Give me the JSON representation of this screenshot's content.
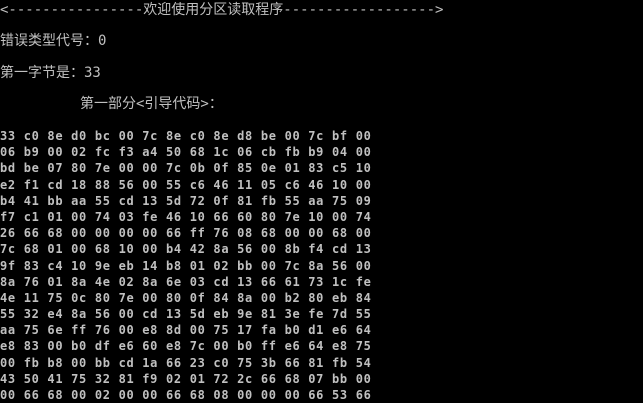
{
  "console": {
    "title_line": "<----------------欢迎使用分区读取程序------------------>",
    "error_type_label": "错误类型代号：",
    "error_type_value": "0",
    "first_byte_label": "第一字节是：",
    "first_byte_value": "33",
    "part1_heading": "第一部分<引导代码>：",
    "hex_rows": [
      "33 c0 8e d0 bc 00 7c 8e c0 8e d8 be 00 7c bf 00",
      "06 b9 00 02 fc f3 a4 50 68 1c 06 cb fb b9 04 00",
      "bd be 07 80 7e 00 00 7c 0b 0f 85 0e 01 83 c5 10",
      "e2 f1 cd 18 88 56 00 55 c6 46 11 05 c6 46 10 00",
      "b4 41 bb aa 55 cd 13 5d 72 0f 81 fb 55 aa 75 09",
      "f7 c1 01 00 74 03 fe 46 10 66 60 80 7e 10 00 74",
      "26 66 68 00 00 00 00 66 ff 76 08 68 00 00 68 00",
      "7c 68 01 00 68 10 00 b4 42 8a 56 00 8b f4 cd 13",
      "9f 83 c4 10 9e eb 14 b8 01 02 bb 00 7c 8a 56 00",
      "8a 76 01 8a 4e 02 8a 6e 03 cd 13 66 61 73 1c fe",
      "4e 11 75 0c 80 7e 00 80 0f 84 8a 00 b2 80 eb 84",
      "55 32 e4 8a 56 00 cd 13 5d eb 9e 81 3e fe 7d 55",
      "aa 75 6e ff 76 00 e8 8d 00 75 17 fa b0 d1 e6 64",
      "e8 83 00 b0 df e6 60 e8 7c 00 b0 ff e6 64 e8 75",
      "00 fb b8 00 bb cd 1a 66 23 c0 75 3b 66 81 fb 54",
      "43 50 41 75 32 81 f9 02 01 72 2c 66 68 07 bb 00",
      "00 66 68 00 02 00 00 66 68 08 00 00 00 66 53 66"
    ]
  }
}
